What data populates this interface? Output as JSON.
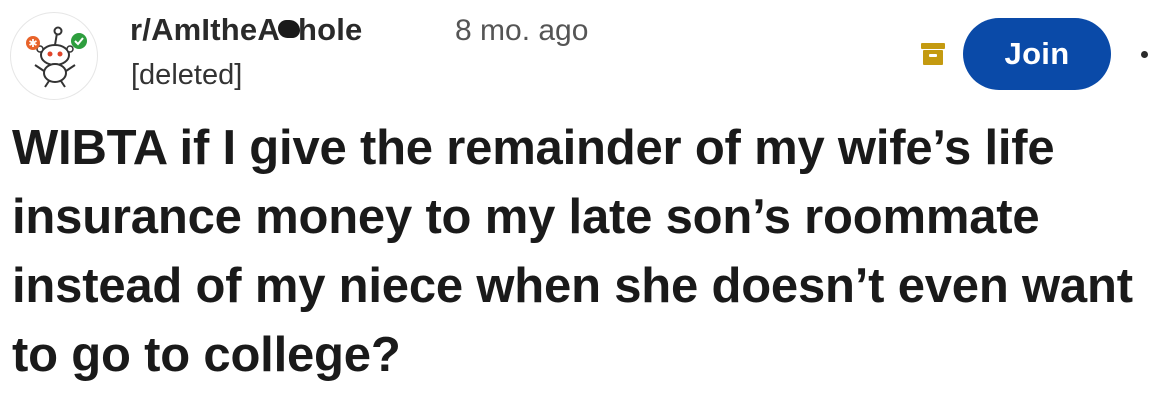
{
  "post": {
    "subreddit_prefix": "r/AmItheA",
    "subreddit_suffix": "hole",
    "time": "8 mo. ago",
    "author": "[deleted]",
    "join_label": "Join",
    "title": "WIBTA if I give the remainder of my wife’s life insurance money to my late son’s roommate instead of my niece when she doesn’t even want to go to college?"
  },
  "icons": {
    "avatar": "reddit-snoo-avatar-icon",
    "archive": "archive-icon",
    "more": "more-options-icon"
  },
  "colors": {
    "join_button": "#0a4aa8",
    "archive_icon": "#c49a10",
    "check_badge": "#2e9e3e",
    "star_badge": "#e8632a"
  }
}
